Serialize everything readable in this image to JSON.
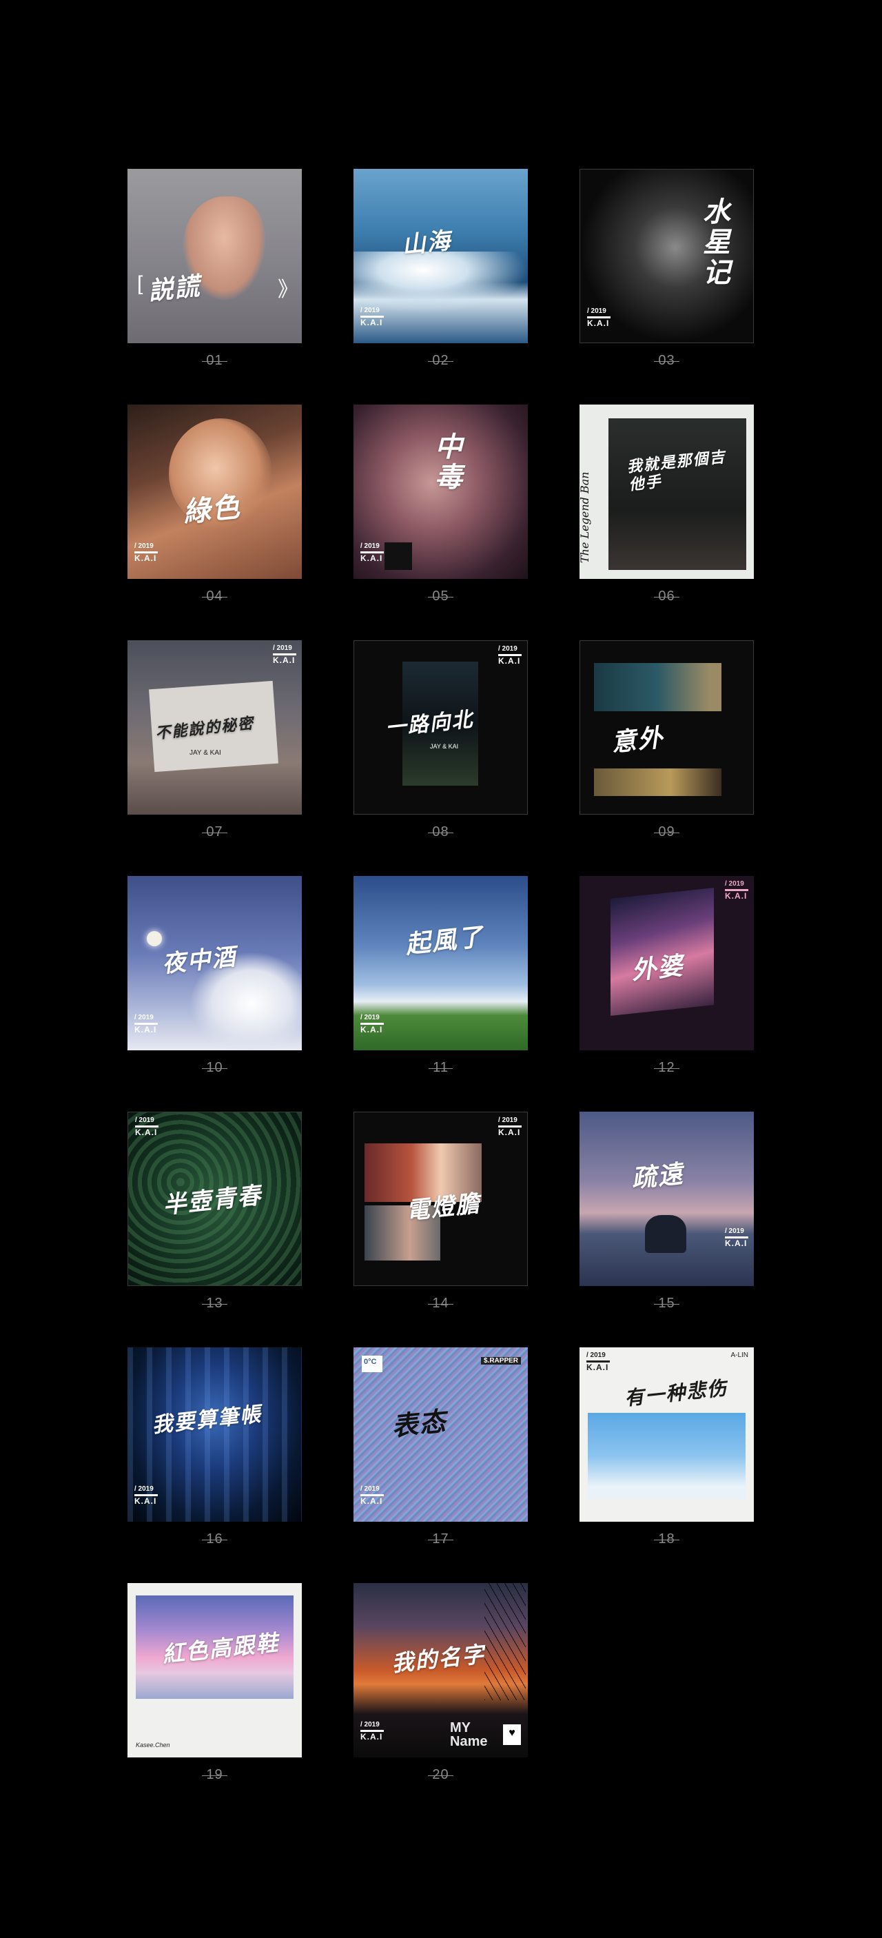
{
  "covers": [
    {
      "number": "01",
      "title": "説謊",
      "brand": ""
    },
    {
      "number": "02",
      "title": "山海",
      "brand": "K.A.I"
    },
    {
      "number": "03",
      "title": "水星记",
      "brand": "K.A.I"
    },
    {
      "number": "04",
      "title": "綠色",
      "brand": "K.A.I"
    },
    {
      "number": "05",
      "title": "中毒",
      "brand": "K.A.I"
    },
    {
      "number": "06",
      "title": "我就是那個吉他手",
      "brand": ""
    },
    {
      "number": "07",
      "title": "不能說的秘密",
      "brand": "K.A.I"
    },
    {
      "number": "08",
      "title": "一路向北",
      "brand": "K.A.I"
    },
    {
      "number": "09",
      "title": "意外",
      "brand": ""
    },
    {
      "number": "10",
      "title": "夜中酒",
      "brand": "K.A.I"
    },
    {
      "number": "11",
      "title": "起風了",
      "brand": "K.A.I"
    },
    {
      "number": "12",
      "title": "外婆",
      "brand": "K.A.I"
    },
    {
      "number": "13",
      "title": "半壺青春",
      "brand": "K.A.I"
    },
    {
      "number": "14",
      "title": "電燈膽",
      "brand": "K.A.I"
    },
    {
      "number": "15",
      "title": "疏遠",
      "brand": "K.A.I"
    },
    {
      "number": "16",
      "title": "我要算筆帳",
      "brand": "K.A.I"
    },
    {
      "number": "17",
      "title": "表态",
      "brand": "K.A.I"
    },
    {
      "number": "18",
      "title": "有一种悲伤",
      "brand": "K.A.I"
    },
    {
      "number": "19",
      "title": "紅色高跟鞋",
      "brand": ""
    },
    {
      "number": "20",
      "title": "我的名字",
      "brand": "K.A.I"
    }
  ],
  "extra": {
    "year": "/ 2019",
    "kai": "K.A.I",
    "jay_kai": "JAY & KAI",
    "kasee": "Kasee.Chen",
    "alin": "A-LIN",
    "rapper": "$.RAPPER",
    "my": "MY",
    "name_word": "Name",
    "degree": "0°C",
    "legend": "The Legend Ban"
  },
  "colors": {
    "background": "#000000",
    "number": "#8a8a8a"
  }
}
